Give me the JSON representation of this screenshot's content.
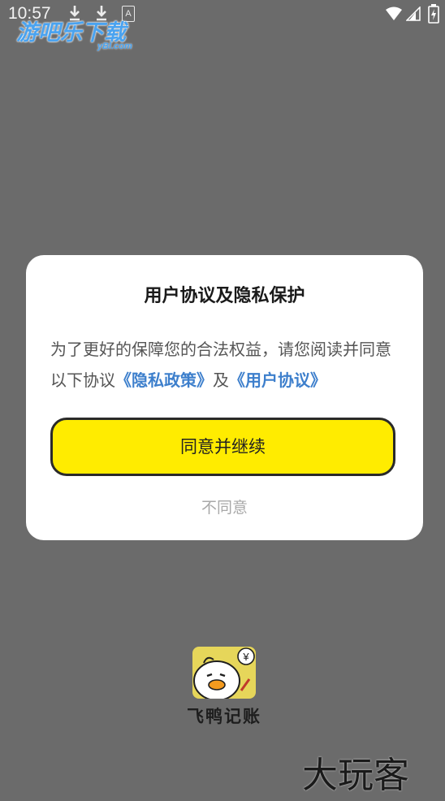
{
  "status_bar": {
    "time": "10:57",
    "notification_a": "A",
    "icons": [
      "download-icon",
      "download-icon",
      "a-notification-icon",
      "wifi-icon",
      "cell-signal-icon",
      "battery-charging-icon"
    ]
  },
  "watermark_top": {
    "main": "游吧乐下载",
    "sub": "yBl.com"
  },
  "dialog": {
    "title": "用户协议及隐私保护",
    "body_prefix": "为了更好的保障您的合法权益，请您阅读并同意以下协议",
    "privacy_link": "《隐私政策》",
    "conjunction": "及",
    "user_agreement_link": "《用户协议》",
    "agree_label": "同意并继续",
    "disagree_label": "不同意"
  },
  "app": {
    "name": "飞鸭记账",
    "logo_badge": "¥"
  },
  "watermark_bottom": "大玩客",
  "colors": {
    "overlay": "#6b6b6b",
    "accent_yellow": "#ffec00",
    "link_blue": "#3d7fcc",
    "watermark_blue": "#4aa3f0"
  }
}
